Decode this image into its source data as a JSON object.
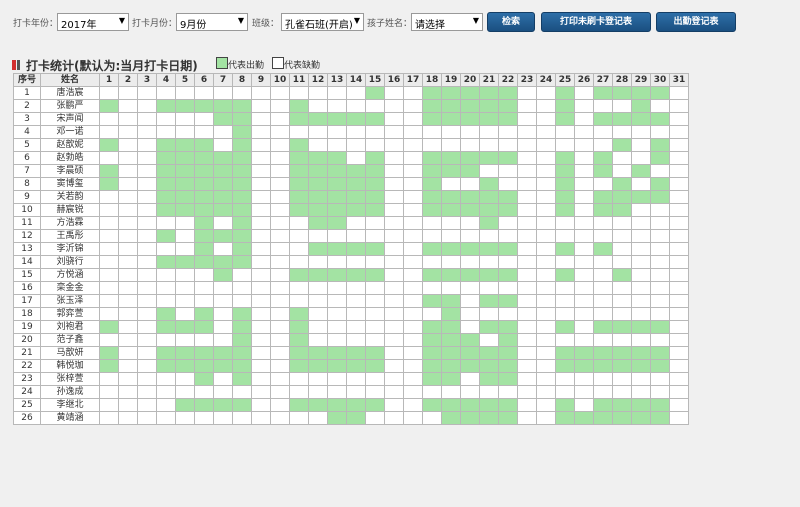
{
  "toolbar": {
    "year_label": "打卡年份：",
    "year_value": "2017年",
    "month_label": "打卡月份：",
    "month_value": "9月份",
    "class_label": "班级：",
    "class_value": "孔雀石班(开启)",
    "child_label": "孩子姓名：",
    "child_value": "请选择",
    "search_button": "检索",
    "print_unswiped_button": "打印未刷卡登记表",
    "print_attendance_button": "出勤登记表"
  },
  "section": {
    "title": "打卡统计(默认为:当月打卡日期)",
    "legend_present": "代表出勤",
    "legend_absent": "代表缺勤",
    "present_color": "#a3e3a3",
    "absent_color": "#ffffff",
    "title_marker_color": "#d32f2f"
  },
  "table": {
    "col_index": "序号",
    "col_name": "姓名",
    "days": [
      "1",
      "2",
      "3",
      "4",
      "5",
      "6",
      "7",
      "8",
      "9",
      "10",
      "11",
      "12",
      "13",
      "14",
      "15",
      "16",
      "17",
      "18",
      "19",
      "20",
      "21",
      "22",
      "23",
      "24",
      "25",
      "26",
      "27",
      "28",
      "29",
      "30",
      "31"
    ],
    "rows": [
      {
        "idx": "1",
        "name": "唐浩宸",
        "present": [
          15,
          18,
          19,
          20,
          21,
          22,
          25,
          27,
          28,
          29,
          30
        ]
      },
      {
        "idx": "2",
        "name": "张鹏严",
        "present": [
          1,
          4,
          5,
          6,
          7,
          8,
          11,
          18,
          19,
          20,
          21,
          22,
          25,
          29
        ]
      },
      {
        "idx": "3",
        "name": "宋声闻",
        "present": [
          7,
          8,
          11,
          12,
          13,
          14,
          15,
          18,
          19,
          20,
          21,
          22,
          25,
          27,
          28,
          29,
          30
        ]
      },
      {
        "idx": "4",
        "name": "邓一诺",
        "present": [
          8
        ]
      },
      {
        "idx": "5",
        "name": "赵歆妮",
        "present": [
          1,
          4,
          5,
          6,
          8,
          11,
          28,
          30
        ]
      },
      {
        "idx": "6",
        "name": "赵勃皓",
        "present": [
          4,
          5,
          6,
          7,
          8,
          11,
          12,
          13,
          15,
          18,
          19,
          20,
          21,
          22,
          25,
          27,
          30
        ]
      },
      {
        "idx": "7",
        "name": "李晨硕",
        "present": [
          1,
          4,
          5,
          6,
          7,
          8,
          11,
          12,
          13,
          14,
          15,
          18,
          19,
          20,
          25,
          27,
          29
        ]
      },
      {
        "idx": "8",
        "name": "窦博玺",
        "present": [
          1,
          4,
          5,
          6,
          7,
          8,
          11,
          12,
          13,
          14,
          15,
          18,
          21,
          25,
          28,
          30
        ]
      },
      {
        "idx": "9",
        "name": "关若韵",
        "present": [
          4,
          5,
          6,
          7,
          8,
          11,
          12,
          13,
          14,
          15,
          18,
          19,
          20,
          21,
          22,
          25,
          27,
          28,
          29,
          30
        ]
      },
      {
        "idx": "10",
        "name": "赫宸锐",
        "present": [
          4,
          5,
          6,
          7,
          8,
          11,
          12,
          13,
          14,
          15,
          18,
          19,
          20,
          21,
          22,
          25,
          27,
          28
        ]
      },
      {
        "idx": "11",
        "name": "方浩霖",
        "present": [
          6,
          8,
          12,
          13,
          21
        ]
      },
      {
        "idx": "12",
        "name": "王禹彤",
        "present": [
          4,
          6,
          7,
          8
        ]
      },
      {
        "idx": "13",
        "name": "李沂锦",
        "present": [
          6,
          8,
          12,
          13,
          14,
          15,
          18,
          19,
          20,
          21,
          22,
          25,
          27
        ]
      },
      {
        "idx": "14",
        "name": "刘骁行",
        "present": [
          4,
          5,
          6,
          7,
          8
        ]
      },
      {
        "idx": "15",
        "name": "方悦涵",
        "present": [
          7,
          11,
          12,
          13,
          14,
          15,
          18,
          19,
          20,
          21,
          22,
          25,
          28
        ]
      },
      {
        "idx": "16",
        "name": "栾金金",
        "present": []
      },
      {
        "idx": "17",
        "name": "张玉泽",
        "present": [
          18,
          19,
          21,
          22
        ]
      },
      {
        "idx": "18",
        "name": "郭弈萱",
        "present": [
          4,
          6,
          8,
          11,
          19
        ]
      },
      {
        "idx": "19",
        "name": "刘袍君",
        "present": [
          1,
          4,
          5,
          6,
          8,
          11,
          18,
          19,
          21,
          22,
          25,
          27,
          28,
          29,
          30
        ]
      },
      {
        "idx": "20",
        "name": "范子鑫",
        "present": [
          8,
          11,
          18,
          19,
          20,
          22
        ]
      },
      {
        "idx": "21",
        "name": "马歆妍",
        "present": [
          1,
          4,
          5,
          6,
          7,
          8,
          11,
          12,
          13,
          14,
          15,
          18,
          19,
          20,
          21,
          22,
          25,
          26,
          27,
          28,
          29,
          30
        ]
      },
      {
        "idx": "22",
        "name": "韩悦珈",
        "present": [
          1,
          4,
          5,
          6,
          7,
          8,
          11,
          12,
          13,
          14,
          15,
          18,
          19,
          20,
          21,
          22,
          25,
          26,
          27,
          28,
          29,
          30
        ]
      },
      {
        "idx": "23",
        "name": "张梓萱",
        "present": [
          6,
          8,
          18,
          19,
          21,
          22
        ]
      },
      {
        "idx": "24",
        "name": "孙逸成",
        "present": []
      },
      {
        "idx": "25",
        "name": "李继北",
        "present": [
          5,
          6,
          7,
          8,
          11,
          12,
          13,
          14,
          15,
          18,
          19,
          20,
          21,
          22,
          25,
          27,
          28,
          29,
          30
        ]
      },
      {
        "idx": "26",
        "name": "黄靖涵",
        "present": [
          13,
          14,
          19,
          20,
          21,
          22,
          25,
          26,
          27,
          28,
          29,
          30
        ]
      }
    ]
  }
}
